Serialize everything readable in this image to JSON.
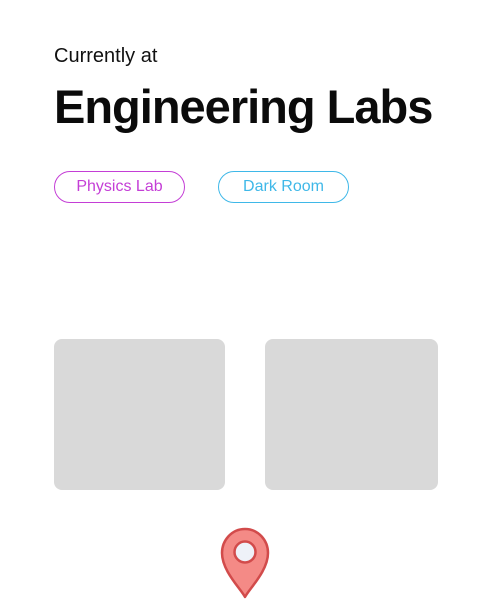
{
  "header": {
    "subtitle": "Currently at",
    "title": "Engineering Labs"
  },
  "tags": [
    {
      "label": "Physics Lab",
      "color": "#c43ed6"
    },
    {
      "label": "Dark Room",
      "color": "#3fb8e8"
    }
  ],
  "cards": [
    {
      "color": "#d9d9d9"
    },
    {
      "color": "#d9d9d9"
    }
  ],
  "location_marker": {
    "icon": "map-pin-icon",
    "fill": "#f48a86",
    "stroke": "#d24b4b"
  }
}
